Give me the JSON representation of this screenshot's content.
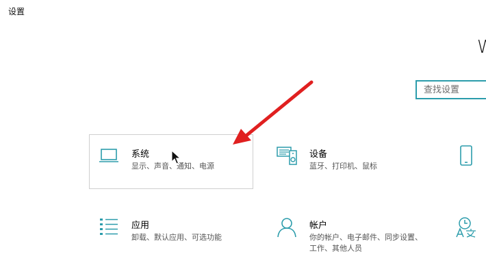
{
  "window": {
    "title": "设置"
  },
  "header": {
    "partial_text": "W"
  },
  "search": {
    "placeholder": "查找设置"
  },
  "tiles": [
    {
      "name": "系统",
      "description": "显示、声音、通知、电源",
      "icon": "laptop-icon"
    },
    {
      "name": "设备",
      "description": "蓝牙、打印机、鼠标",
      "icon": "devices-icon"
    },
    {
      "name": "",
      "description": "",
      "icon": "phone-icon"
    },
    {
      "name": "应用",
      "description": "卸载、默认应用、可选功能",
      "icon": "apps-list-icon"
    },
    {
      "name": "帐户",
      "description": "你的帐户、电子邮件、同步设置、工作、其他人员",
      "icon": "person-icon"
    },
    {
      "name": "",
      "description": "",
      "icon": "time-language-icon"
    }
  ],
  "colors": {
    "accent": "#2b9cab",
    "annotation_arrow": "#e02020",
    "hover_border": "#cfcfcf"
  }
}
